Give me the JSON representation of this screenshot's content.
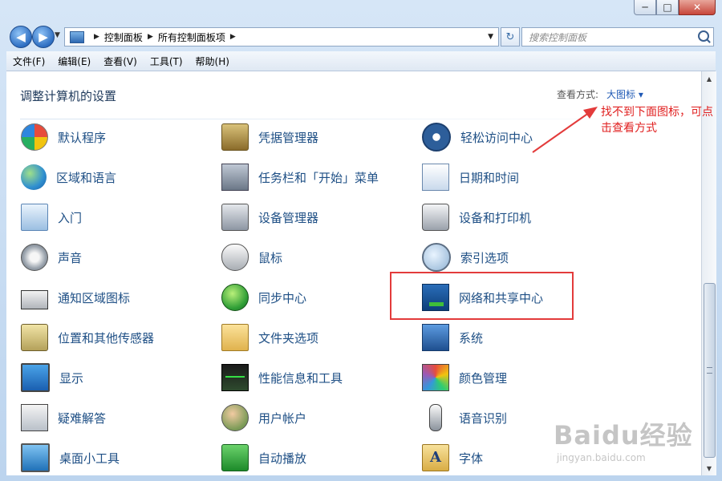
{
  "window": {
    "caption": {
      "minimize": "─",
      "maximize": "□",
      "close": "✕"
    }
  },
  "nav": {
    "back": "◀",
    "forward": "▶",
    "breadcrumb": [
      "控制面板",
      "所有控制面板项"
    ],
    "search_placeholder": "搜索控制面板"
  },
  "menu": [
    "文件(F)",
    "编辑(E)",
    "查看(V)",
    "工具(T)",
    "帮助(H)"
  ],
  "content": {
    "heading": "调整计算机的设置",
    "view_label": "查看方式:",
    "view_value": "大图标 ▾"
  },
  "items": [
    [
      "默认程序",
      "凭据管理器",
      "轻松访问中心"
    ],
    [
      "区域和语言",
      "任务栏和「开始」菜单",
      "日期和时间"
    ],
    [
      "入门",
      "设备管理器",
      "设备和打印机"
    ],
    [
      "声音",
      "鼠标",
      "索引选项"
    ],
    [
      "通知区域图标",
      "同步中心",
      "网络和共享中心"
    ],
    [
      "位置和其他传感器",
      "文件夹选项",
      "系统"
    ],
    [
      "显示",
      "性能信息和工具",
      "颜色管理"
    ],
    [
      "疑难解答",
      "用户帐户",
      "语音识别"
    ],
    [
      "桌面小工具",
      "自动播放",
      "字体"
    ]
  ],
  "icons": [
    [
      "default-programs-icon",
      "credential-manager-icon",
      "ease-of-access-icon"
    ],
    [
      "region-language-icon",
      "taskbar-start-menu-icon",
      "date-time-icon"
    ],
    [
      "getting-started-icon",
      "device-manager-icon",
      "devices-printers-icon"
    ],
    [
      "sound-icon",
      "mouse-icon",
      "indexing-options-icon"
    ],
    [
      "notification-area-icon",
      "sync-center-icon",
      "network-sharing-icon"
    ],
    [
      "location-sensors-icon",
      "folder-options-icon",
      "system-icon"
    ],
    [
      "display-icon",
      "performance-icon",
      "color-management-icon"
    ],
    [
      "troubleshooting-icon",
      "user-accounts-icon",
      "speech-recognition-icon"
    ],
    [
      "desktop-gadgets-icon",
      "autoplay-icon",
      "fonts-icon"
    ]
  ],
  "annotation": {
    "text": "找不到下面图标，可点击查看方式",
    "color": "#e33b3b"
  },
  "watermark": {
    "logo": "Baidu经验",
    "url": "jingyan.baidu.com"
  },
  "colors": {
    "link": "#1e4f85",
    "heading": "#1e395b",
    "accent": "#1f59b5"
  }
}
